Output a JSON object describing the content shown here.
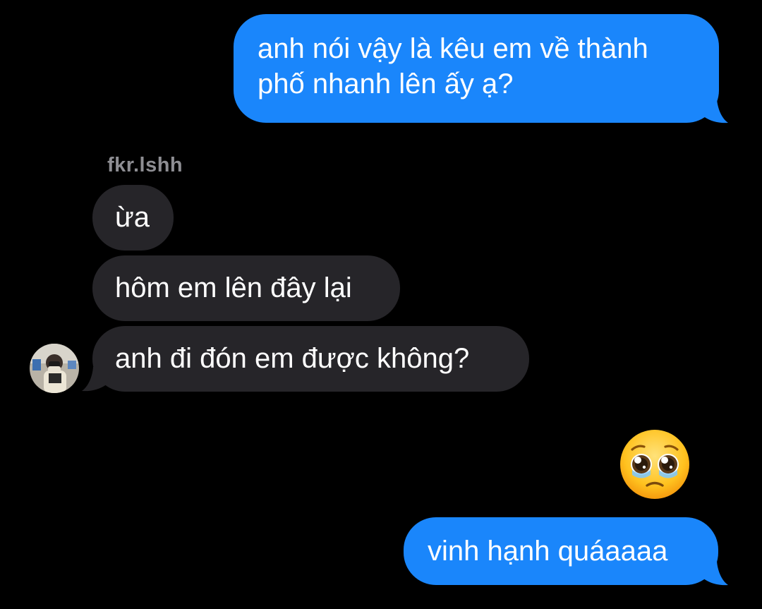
{
  "conversation": {
    "messages": [
      {
        "direction": "outgoing",
        "lines": [
          "anh nói vậy là kêu em về thành",
          "phố nhanh lên ấy ạ?"
        ]
      },
      {
        "direction": "incoming",
        "text": "ừa"
      },
      {
        "direction": "incoming",
        "text": "hôm em lên đây lại"
      },
      {
        "direction": "incoming",
        "text": "anh đi đón em được không?"
      },
      {
        "direction": "outgoing",
        "type": "emoji",
        "emoji": "pleading-face-with-tears"
      },
      {
        "direction": "outgoing",
        "text": "vinh hạnh quáaaaa"
      }
    ],
    "sender": {
      "name": "fkr.lshh",
      "avatar": "profile-photo"
    }
  },
  "colors": {
    "background": "#000000",
    "outgoing_bubble": "#1a86fb",
    "incoming_bubble": "#262529",
    "bubble_text": "#ffffff",
    "sender_name": "#8e8e93"
  }
}
